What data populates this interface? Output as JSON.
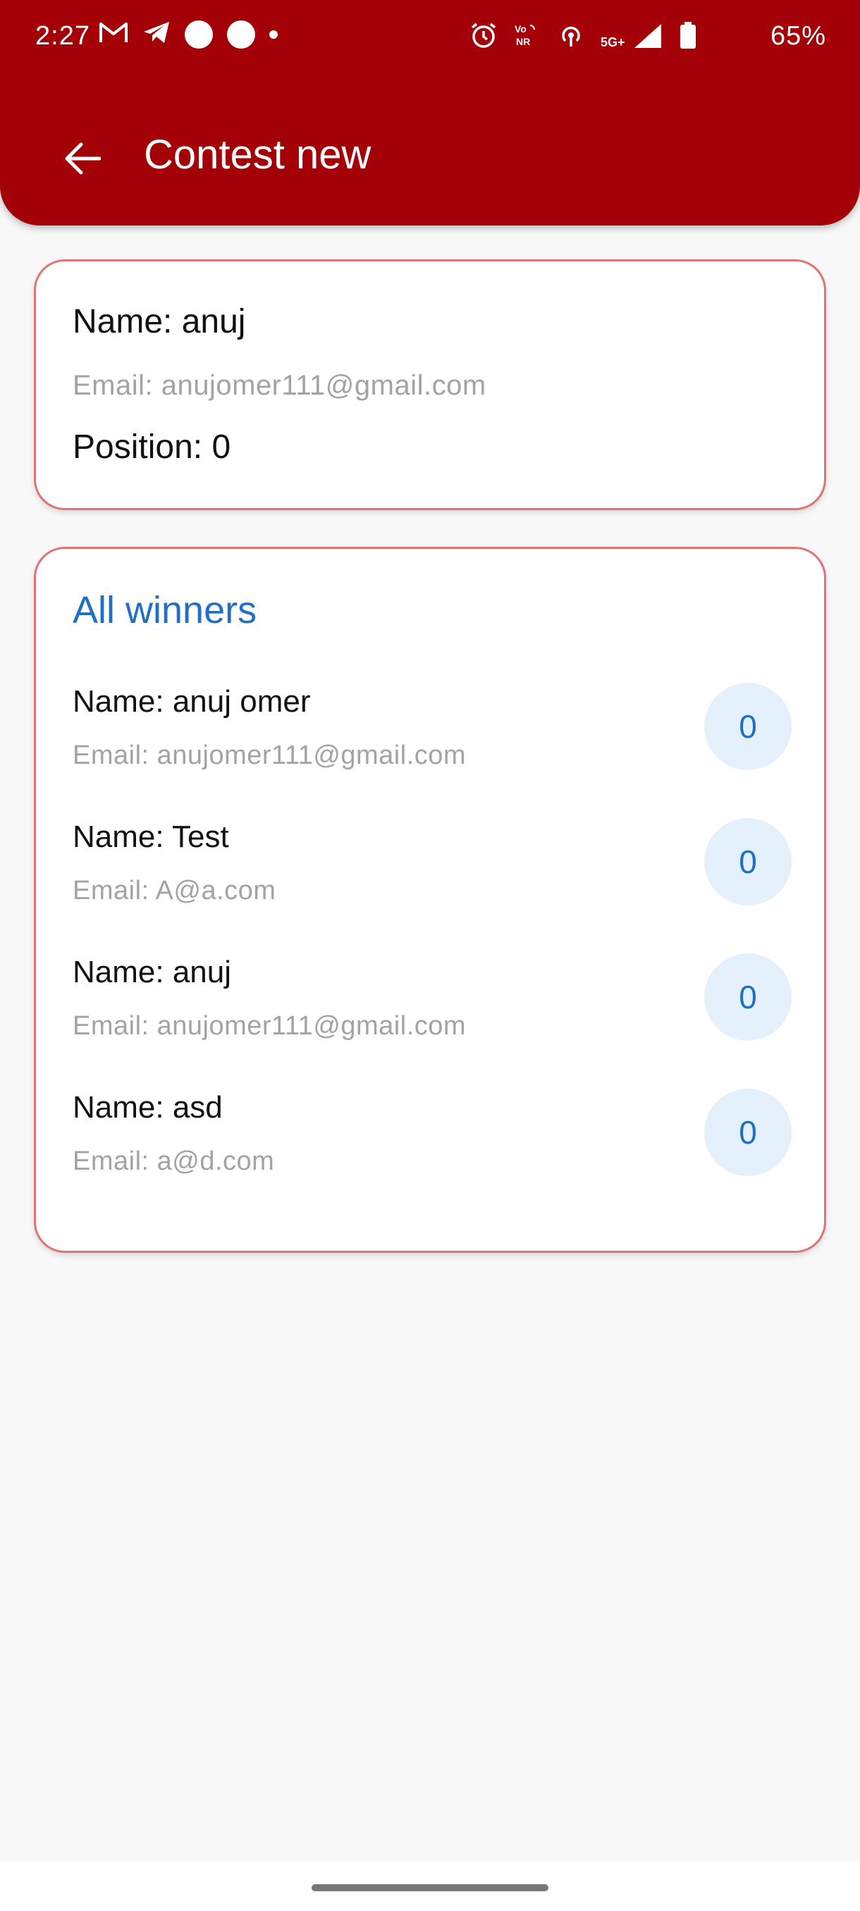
{
  "status_bar": {
    "time": "2:27",
    "battery": "65%",
    "network": "5G+"
  },
  "header": {
    "title": "Contest new"
  },
  "profile": {
    "name": "Name: anuj",
    "email": "Email: anujomer111@gmail.com",
    "position": "Position: 0"
  },
  "winners": {
    "title": "All winners",
    "items": [
      {
        "name": "Name: anuj omer",
        "email": "Email: anujomer111@gmail.com",
        "position": "0"
      },
      {
        "name": "Name: Test",
        "email": "Email: A@a.com",
        "position": "0"
      },
      {
        "name": "Name: anuj",
        "email": "Email: anujomer111@gmail.com",
        "position": "0"
      },
      {
        "name": "Name: asd",
        "email": "Email: a@d.com",
        "position": "0"
      }
    ]
  },
  "colors": {
    "header_bg": "#a30008",
    "card_border": "#e07474",
    "accent_blue": "#1f6fc6",
    "badge_bg": "#e4f1fc"
  },
  "icons": {
    "back": "arrow-back-icon",
    "gmail": "gmail-icon",
    "telegram": "telegram-icon",
    "alarm": "alarm-icon",
    "volte": "vonr-icon",
    "hotspot": "hotspot-icon",
    "signal": "signal-icon",
    "battery": "battery-icon"
  }
}
